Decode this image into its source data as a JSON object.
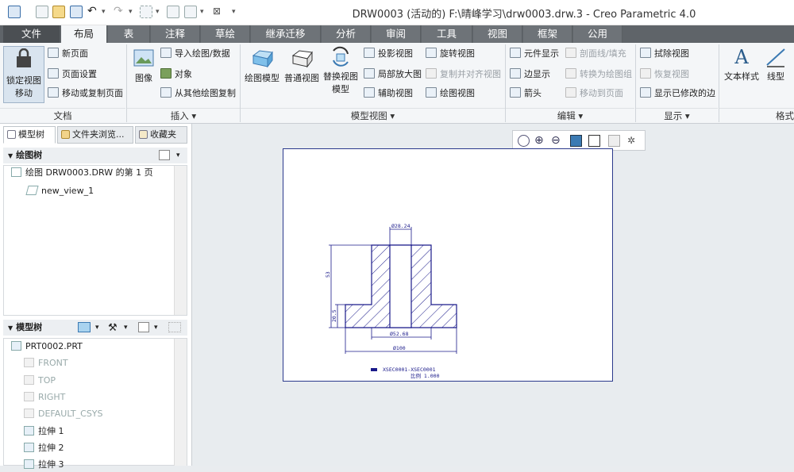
{
  "window": {
    "title": "DRW0003 (活动的) F:\\晴峰学习\\drw0003.drw.3 - Creo Parametric 4.0"
  },
  "menu": [
    "文件",
    "布局",
    "表",
    "注释",
    "草绘",
    "继承迁移",
    "分析",
    "审阅",
    "工具",
    "视图",
    "框架",
    "公用"
  ],
  "ribbon": {
    "doc": {
      "lock": "锁定视图",
      "lock2": "移动",
      "new_page": "新页面",
      "page_setup": "页面设置",
      "move_copy": "移动或复制页面",
      "group": "文档"
    },
    "insert": {
      "image": "图像",
      "import": "导入绘图/数据",
      "object": "对象",
      "copy_from": "从其他绘图复制",
      "group": "插入"
    },
    "model_views": {
      "drawing_model": "绘图模型",
      "general": "普通视图",
      "replace1": "替换视图",
      "replace2": "模型",
      "projection": "投影视图",
      "detailed": "局部放大图",
      "auxiliary": "辅助视图",
      "revolved": "旋转视图",
      "copy_align": "复制并对齐视图",
      "drawing_view": "绘图视图",
      "group": "模型视图"
    },
    "edit": {
      "component_display": "元件显示",
      "section_fill": "剖面线/填充",
      "edge_display": "边显示",
      "convert_to_draw": "转换为绘图组",
      "arrow": "箭头",
      "move_to_page": "移动到页面",
      "group": "编辑"
    },
    "display": {
      "erase": "拭除视图",
      "restore": "恢复视图",
      "show_modified": "显示已修改的边",
      "group": "显示"
    },
    "format": {
      "text_style": "文本样式",
      "line_style": "线型",
      "group": "格式"
    }
  },
  "panel": {
    "tabs": [
      "模型树",
      "文件夹浏览...",
      "收藏夹"
    ],
    "drawing_tree": {
      "title": "绘图树",
      "items": [
        "绘图 DRW0003.DRW 的第 1 页",
        "new_view_1"
      ]
    },
    "model_tree": {
      "title": "模型树",
      "items": [
        {
          "label": "PRT0002.PRT",
          "dim": false
        },
        {
          "label": "FRONT",
          "dim": true
        },
        {
          "label": "TOP",
          "dim": true
        },
        {
          "label": "RIGHT",
          "dim": true
        },
        {
          "label": "DEFAULT_CSYS",
          "dim": true
        },
        {
          "label": "拉伸 1",
          "dim": false
        },
        {
          "label": "拉伸 2",
          "dim": false
        },
        {
          "label": "拉伸 3",
          "dim": false
        }
      ]
    }
  },
  "drawing": {
    "dim_top": "Ø28.24",
    "dim_mid": "Ø52.68",
    "dim_bottom": "Ø100",
    "dim_height": "53",
    "dim_flange": "20.5",
    "section_label": "XSEC0001-XSEC0001",
    "scale_label": "比例  1.000"
  },
  "colors": {
    "menu_bg": "#5f6469",
    "sheet_border": "#2b3a8c",
    "dim": "#1a1a8a"
  }
}
